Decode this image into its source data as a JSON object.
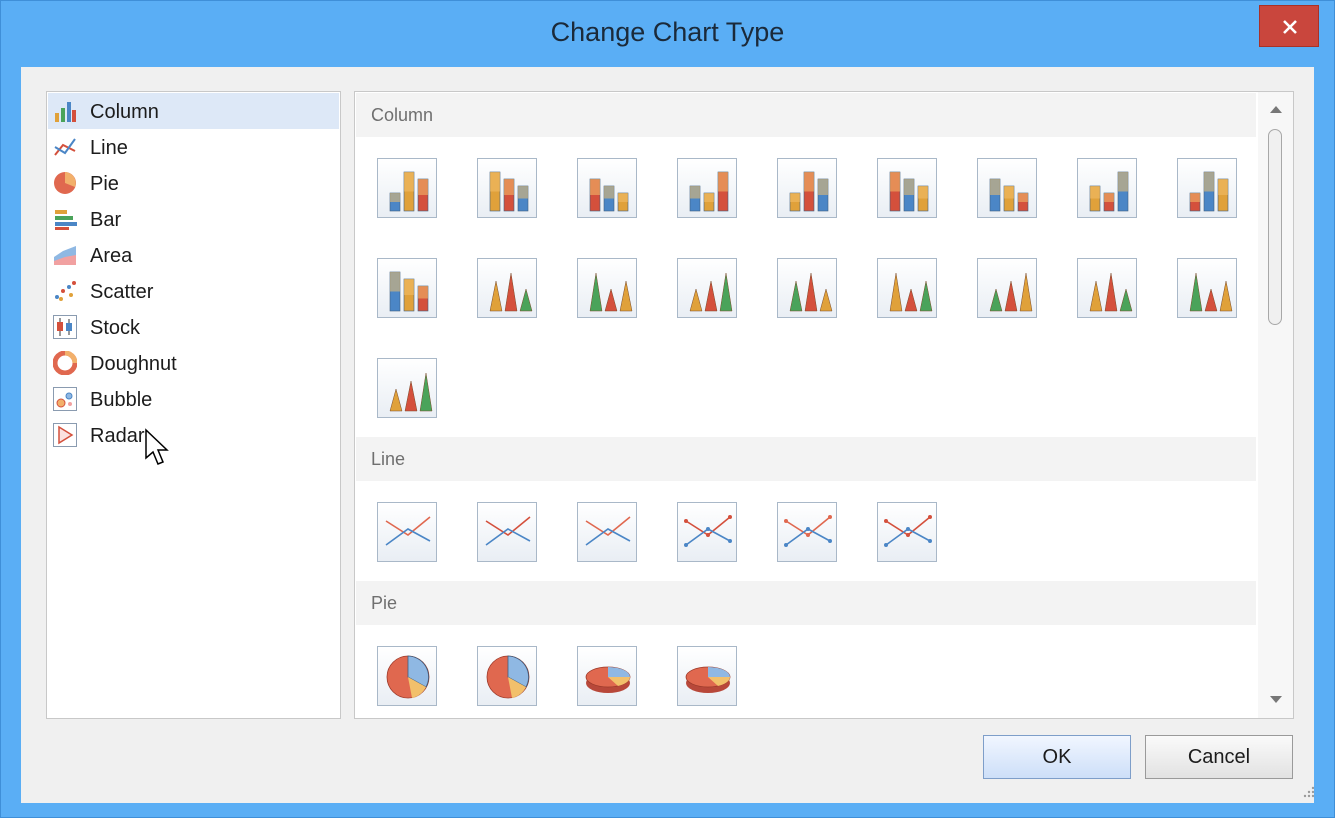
{
  "window": {
    "title": "Change Chart Type"
  },
  "chart_types": [
    {
      "label": "Column",
      "icon": "column-chart-icon"
    },
    {
      "label": "Line",
      "icon": "line-chart-icon"
    },
    {
      "label": "Pie",
      "icon": "pie-chart-icon"
    },
    {
      "label": "Bar",
      "icon": "bar-chart-icon"
    },
    {
      "label": "Area",
      "icon": "area-chart-icon"
    },
    {
      "label": "Scatter",
      "icon": "scatter-chart-icon"
    },
    {
      "label": "Stock",
      "icon": "stock-chart-icon"
    },
    {
      "label": "Doughnut",
      "icon": "doughnut-chart-icon"
    },
    {
      "label": "Bubble",
      "icon": "bubble-chart-icon"
    },
    {
      "label": "Radar",
      "icon": "radar-chart-icon"
    }
  ],
  "selected_type": "Column",
  "gallery": {
    "groups": [
      {
        "name": "Column",
        "thumbnail_count": 19
      },
      {
        "name": "Line",
        "thumbnail_count": 6
      },
      {
        "name": "Pie",
        "thumbnail_count": 4
      }
    ]
  },
  "buttons": {
    "ok": "OK",
    "cancel": "Cancel"
  },
  "colors": {
    "title_bar": "#5aaef5",
    "close_button": "#c9463d",
    "selection": "#dde8f7"
  }
}
